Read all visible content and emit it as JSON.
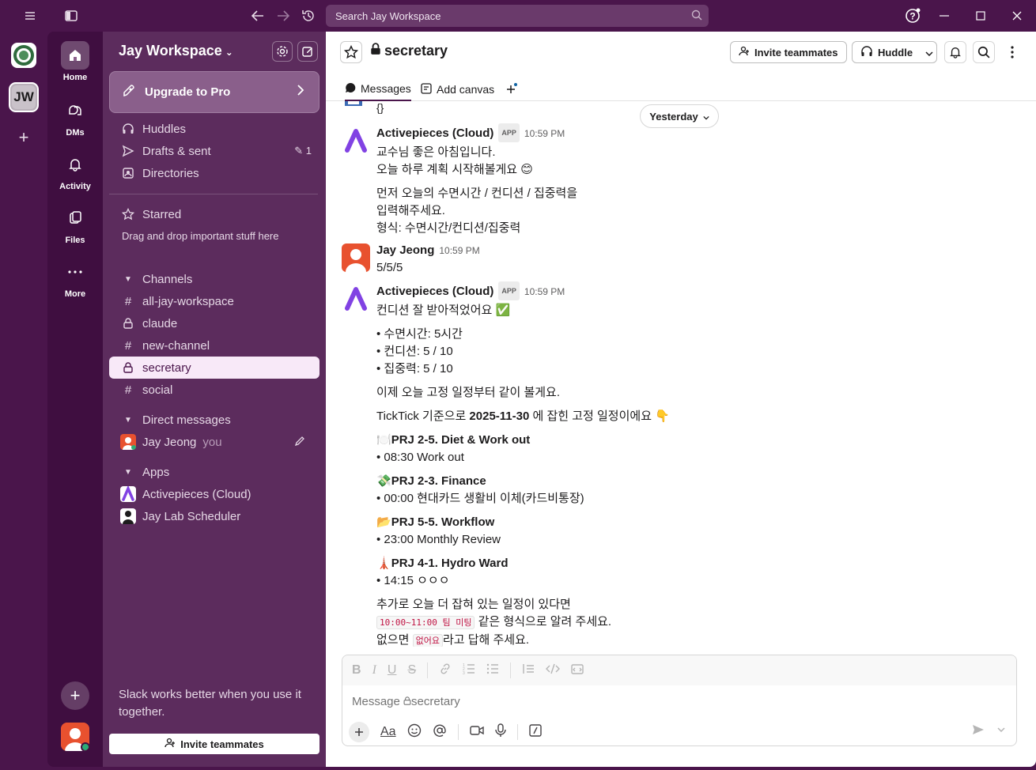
{
  "search": {
    "placeholder": "Search Jay Workspace"
  },
  "rail": {
    "workspace_initials": "JW"
  },
  "nav": {
    "home": "Home",
    "dms": "DMs",
    "activity": "Activity",
    "files": "Files",
    "more": "More"
  },
  "sidebar": {
    "workspace_name": "Jay Workspace",
    "upgrade": "Upgrade to Pro",
    "huddles": "Huddles",
    "drafts": "Drafts & sent",
    "drafts_count": "1",
    "directories": "Directories",
    "starred": "Starred",
    "starred_hint": "Drag and drop important stuff here",
    "channels_header": "Channels",
    "channels": [
      "all-jay-workspace",
      "claude",
      "new-channel",
      "secretary",
      "social"
    ],
    "dm_header": "Direct messages",
    "dm_user": "Jay Jeong",
    "dm_you": "you",
    "apps_header": "Apps",
    "apps": [
      "Activepieces (Cloud)",
      "Jay Lab Scheduler"
    ],
    "footer_text": "Slack works better when you use it together.",
    "invite": "Invite teammates"
  },
  "channel": {
    "name": "secretary",
    "invite": "Invite teammates",
    "huddle": "Huddle",
    "tab_messages": "Messages",
    "tab_canvas": "Add canvas"
  },
  "messages": {
    "top_fragment": "{}",
    "date_divider": "Yesterday",
    "m1": {
      "author": "Activepieces (Cloud)",
      "tag": "APP",
      "time": "10:59 PM",
      "l1": "교수님 좋은 아침입니다.",
      "l2": "오늘 하루 계획 시작해볼게요 😊",
      "l3": "먼저 오늘의 수면시간 / 컨디션 / 집중력을",
      "l4": "입력해주세요.",
      "l5": "형식: 수면시간/컨디션/집중력"
    },
    "m2": {
      "author": "Jay Jeong",
      "time": "10:59 PM",
      "l1": "5/5/5"
    },
    "m3": {
      "author": "Activepieces (Cloud)",
      "tag": "APP",
      "time": "10:59 PM",
      "l1": "컨디션 잘 받아적었어요 ✅",
      "b1": "• 수면시간: 5시간",
      "b2": "• 컨디션: 5 / 10",
      "b3": "• 집중력: 5 / 10",
      "l2": "이제 오늘 고정 일정부터 같이 볼게요.",
      "l3a": "TickTick 기준으로 ",
      "l3b": "2025-11-30",
      "l3c": " 에 잡힌 고정 일정이에요 👇",
      "p1_icon": "🍽️",
      "p1": "PRJ 2-5. Diet & Work out",
      "p1_item": "• 08:30 Work out",
      "p2_icon": "💸",
      "p2": "PRJ 2-3. Finance",
      "p2_item": "• 00:00 현대카드 생활비 이체(카드비통장)",
      "p3_icon": "📂",
      "p3": "PRJ 5-5. Workflow",
      "p3_item": "• 23:00 Monthly Review",
      "p4_icon": "🗼",
      "p4": "PRJ 4-1. Hydro Ward",
      "p4_item": "• 14:15 ㅇㅇㅇ",
      "l4": "추가로 오늘 더 잡혀 있는 일정이 있다면",
      "code1": "10:00~11:00 팀 미팅",
      "l5": " 같은 형식으로 알려 주세요.",
      "l6a": "없으면 ",
      "code2": "없어요",
      "l6b": "라고 답해 주세요."
    }
  },
  "composer": {
    "placeholder_prefix": "Message ",
    "placeholder_channel": "secretary"
  },
  "colors": {
    "aubergine": "#4a154b",
    "sidebar": "#5c2c5d",
    "nav": "#3f0e40",
    "activepieces": "#8142e3",
    "avatar_red": "#e8512f"
  }
}
